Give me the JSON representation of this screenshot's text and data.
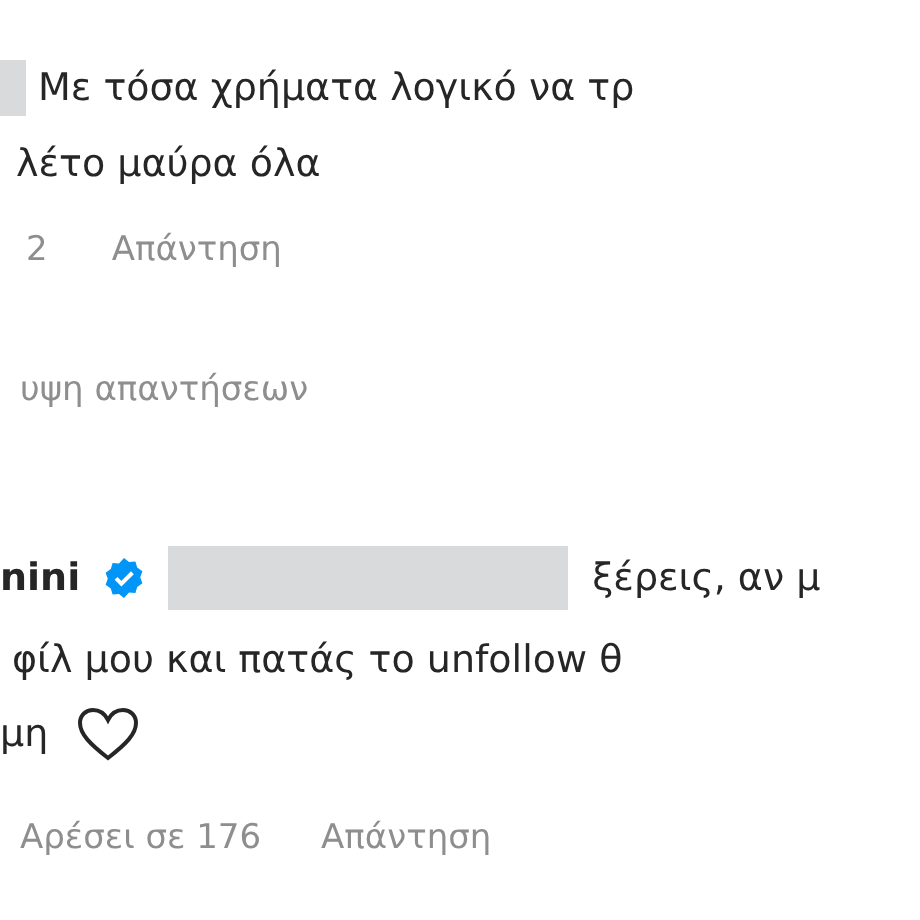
{
  "comment": {
    "lines": [
      "Με τόσα χρήματα λογικό να τρ",
      "λέτο μαύρα όλα"
    ],
    "likes": "2",
    "reply": "Απάντηση"
  },
  "replies_toggle": "υψη απαντήσεων",
  "reply": {
    "username": "nini",
    "verified": true,
    "lines": [
      "ξέρεις, αν μ",
      "φίλ μου και πατάς το unfollow θ",
      "μη"
    ],
    "likes": "Αρέσει σε 176",
    "reply": "Απάντηση"
  }
}
